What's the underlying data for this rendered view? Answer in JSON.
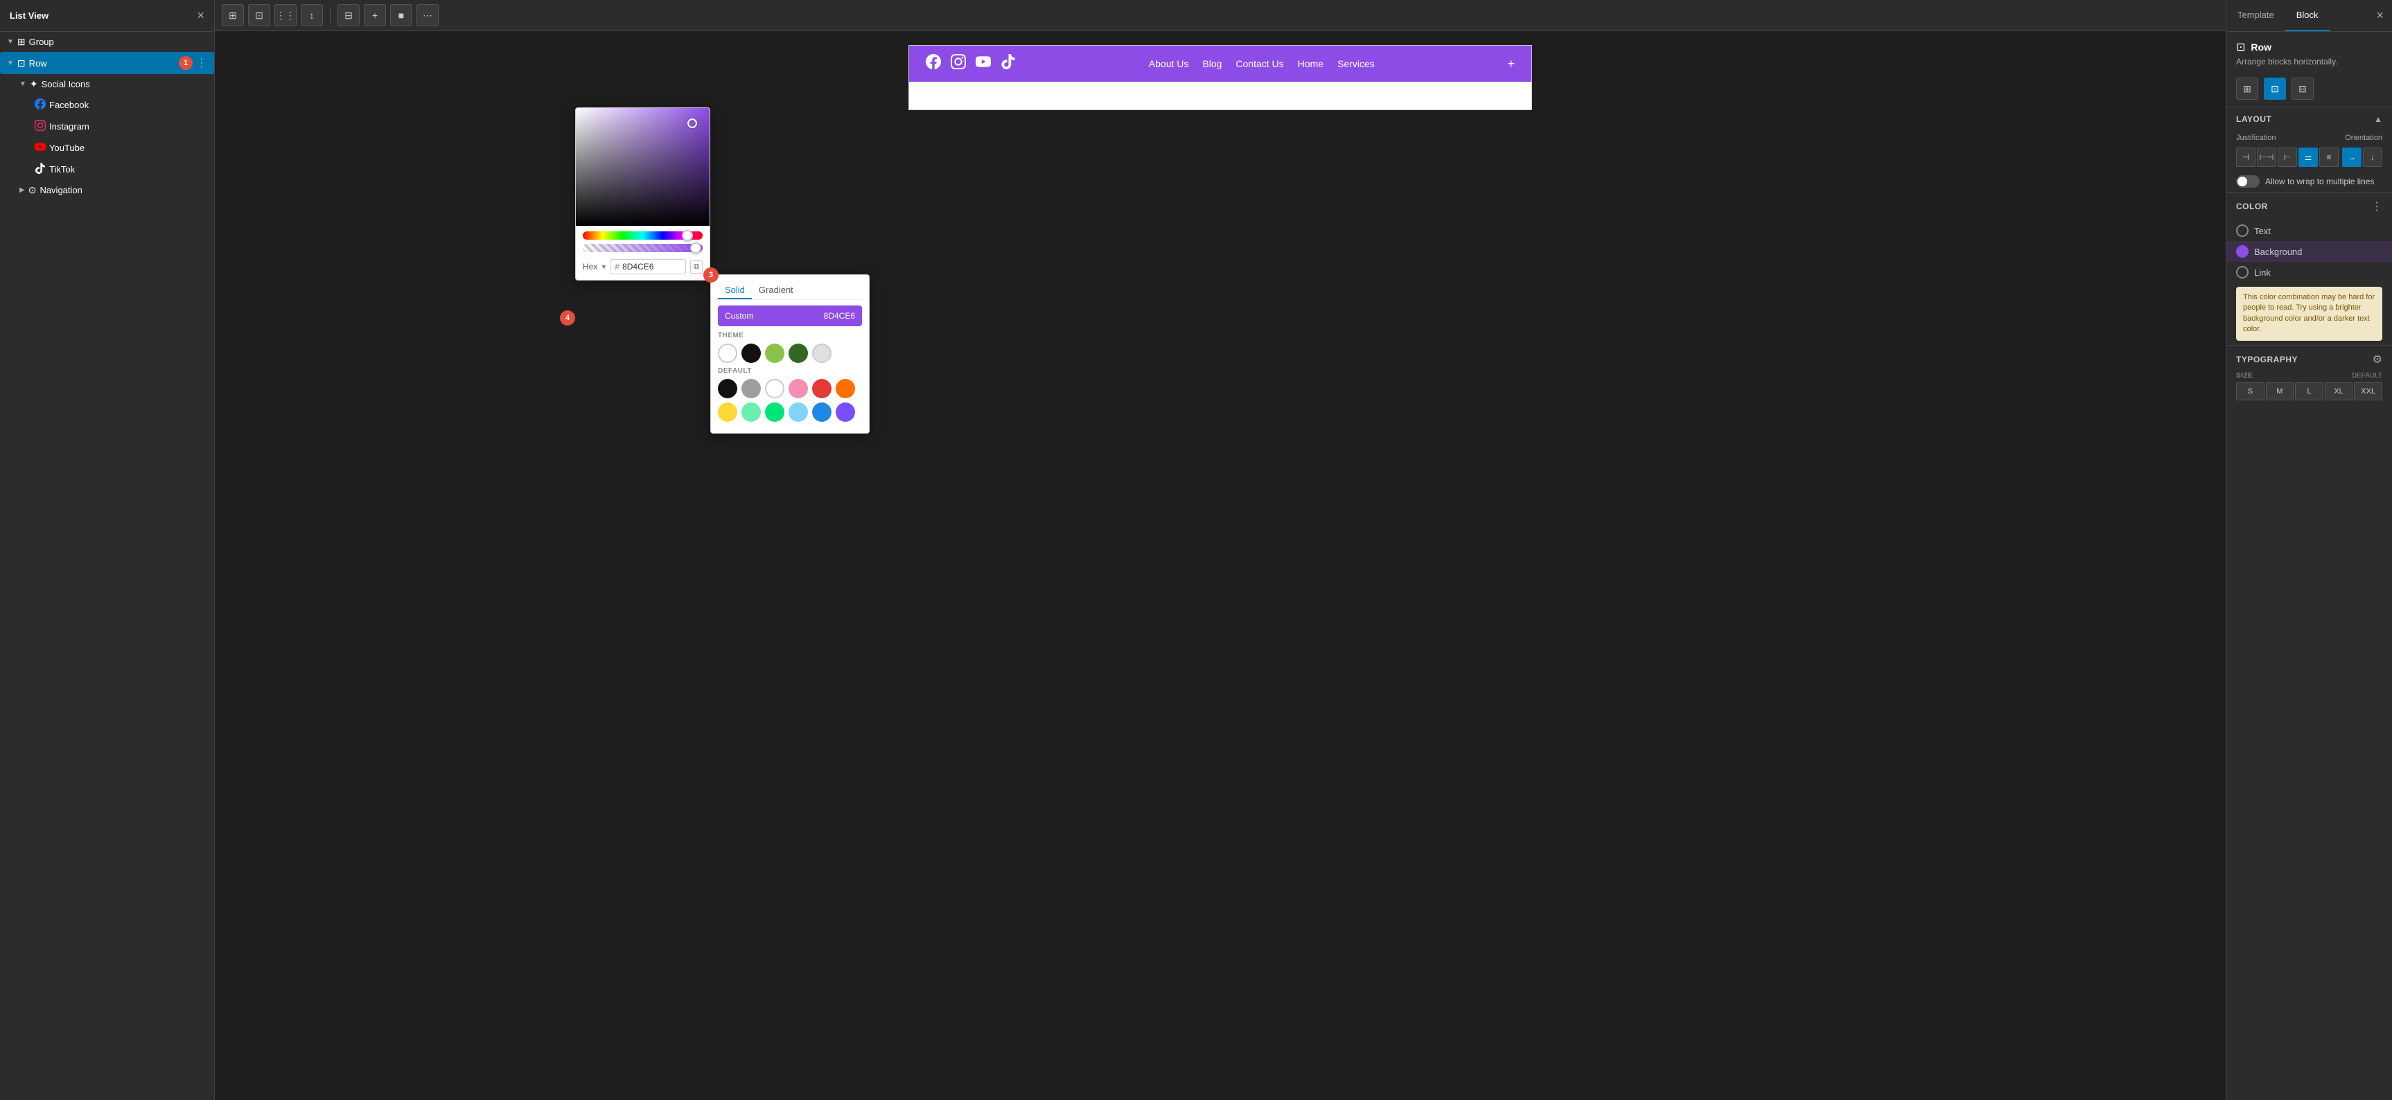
{
  "leftPanel": {
    "title": "List View",
    "closeLabel": "×",
    "tree": [
      {
        "id": "group",
        "label": "Group",
        "level": 0,
        "icon": "group",
        "expanded": true,
        "hasChevron": true
      },
      {
        "id": "row",
        "label": "Row",
        "level": 0,
        "icon": "row",
        "expanded": true,
        "hasChevron": true,
        "selected": true,
        "badge": "1"
      },
      {
        "id": "social-icons",
        "label": "Social Icons",
        "level": 1,
        "icon": "social",
        "expanded": true,
        "hasChevron": true
      },
      {
        "id": "facebook",
        "label": "Facebook",
        "level": 2,
        "icon": "facebook"
      },
      {
        "id": "instagram",
        "label": "Instagram",
        "level": 2,
        "icon": "instagram"
      },
      {
        "id": "youtube",
        "label": "YouTube",
        "level": 2,
        "icon": "youtube"
      },
      {
        "id": "tiktok",
        "label": "TikTok",
        "level": 2,
        "icon": "tiktok"
      },
      {
        "id": "navigation",
        "label": "Navigation",
        "level": 1,
        "icon": "navigation",
        "hasChevron": true
      }
    ]
  },
  "toolbar": {
    "buttons": [
      "⊞",
      "⊡",
      "⋮⋮",
      "↕",
      "⊟",
      "+",
      "■",
      "⋯"
    ]
  },
  "header": {
    "socialIcons": [
      "facebook",
      "instagram",
      "youtube",
      "tiktok"
    ],
    "navLinks": [
      "About Us",
      "Blog",
      "Contact Us",
      "Home",
      "Services"
    ],
    "bgColor": "#8D4CE6"
  },
  "colorPicker": {
    "hexLabel": "Hex",
    "hexValue": "8D4CE6",
    "copyBtn": "⧉"
  },
  "colorOptions": {
    "solidLabel": "Solid",
    "gradientLabel": "Gradient",
    "customLabel": "Custom",
    "customValue": "8D4CE6",
    "themeLabel": "THEME",
    "defaultLabel": "DEFAULT",
    "themeColors": [
      "#fff",
      "#111",
      "#8BC34A",
      "#33691E",
      "#e0e0e0"
    ],
    "defaultColors": [
      "#111",
      "#9e9e9e",
      "#fff",
      "#f48fb1",
      "#e53935",
      "#ff6f00",
      "#fdd835",
      "#69f0ae",
      "#00e676",
      "#81d4fa",
      "#1e88e5",
      "#7c4dff"
    ],
    "badges": {
      "badge3": "3",
      "badge4": "4"
    }
  },
  "rightPanel": {
    "tabs": [
      "Template",
      "Block"
    ],
    "activeTab": "Block",
    "closeLabel": "×",
    "blockName": "Row",
    "blockDesc": "Arrange blocks horizontally.",
    "layout": {
      "label": "Layout",
      "justificationLabel": "Justification",
      "orientationLabel": "Orientation",
      "justBtns": [
        "⊣",
        "⊢",
        "⊢⊣",
        "⊟",
        "≡"
      ],
      "orientBtns": [
        "→",
        "↓"
      ],
      "wrapLabel": "Allow to wrap to multiple lines"
    },
    "colorSection": {
      "label": "Color",
      "items": [
        {
          "id": "text",
          "label": "Text",
          "colorType": "outline"
        },
        {
          "id": "background",
          "label": "Background",
          "colorType": "purple",
          "active": true
        },
        {
          "id": "link",
          "label": "Link",
          "colorType": "outline"
        }
      ],
      "warning": "This color combination may be hard for people to read. Try using a brighter background color and/or a darker text color."
    },
    "typography": {
      "label": "Typography",
      "sizeLabel": "SIZE",
      "sizeDefault": "DEFAULT",
      "sizes": [
        "S",
        "M",
        "L",
        "XL",
        "XXL"
      ]
    }
  }
}
